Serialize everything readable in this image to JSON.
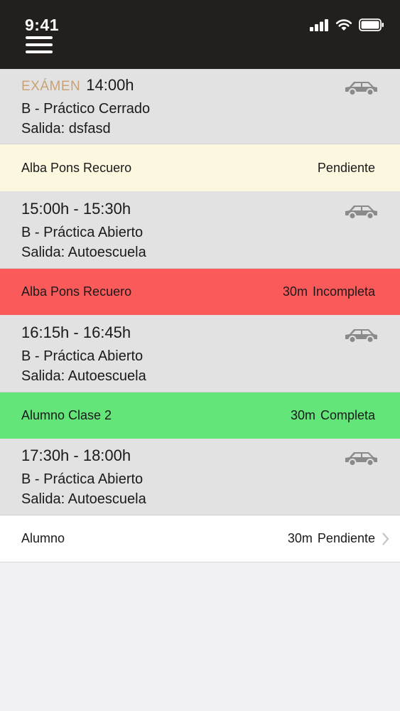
{
  "status_bar": {
    "time": "9:41"
  },
  "lessons": [
    {
      "exam_label": "EXÁMEN",
      "time": "14:00h",
      "type": "B - Práctico Cerrado",
      "departure_label": "Salida:",
      "departure": "dsfasd",
      "student": "Alba Pons Recuero",
      "duration": "",
      "status": "Pendiente",
      "status_color": "#fcf8e0"
    },
    {
      "time": "15:00h - 15:30h",
      "type": "B - Práctica Abierto",
      "departure_label": "Salida:",
      "departure": "Autoescuela",
      "student": "Alba Pons Recuero",
      "duration": "30m",
      "status": "Incompleta",
      "status_color": "#fb5a5a"
    },
    {
      "time": "16:15h - 16:45h",
      "type": "B - Práctica Abierto",
      "departure_label": "Salida:",
      "departure": "Autoescuela",
      "student": "Alumno Clase 2",
      "duration": "30m",
      "status": "Completa",
      "status_color": "#63e57a"
    },
    {
      "time": "17:30h - 18:00h",
      "type": "B - Práctica Abierto",
      "departure_label": "Salida:",
      "departure": "Autoescuela",
      "student": "Alumno",
      "duration": "30m",
      "status": "Pendiente",
      "status_color": "#ffffff"
    }
  ],
  "colors": {
    "header_bg": "#221f1c",
    "lesson_bg": "#e3e2e3",
    "exam_label": "#c8a274",
    "car_icon": "#8a8a8a"
  },
  "icons": {
    "menu": "hamburger-menu-icon",
    "car": "car-icon",
    "chevron": "chevron-right-icon"
  }
}
